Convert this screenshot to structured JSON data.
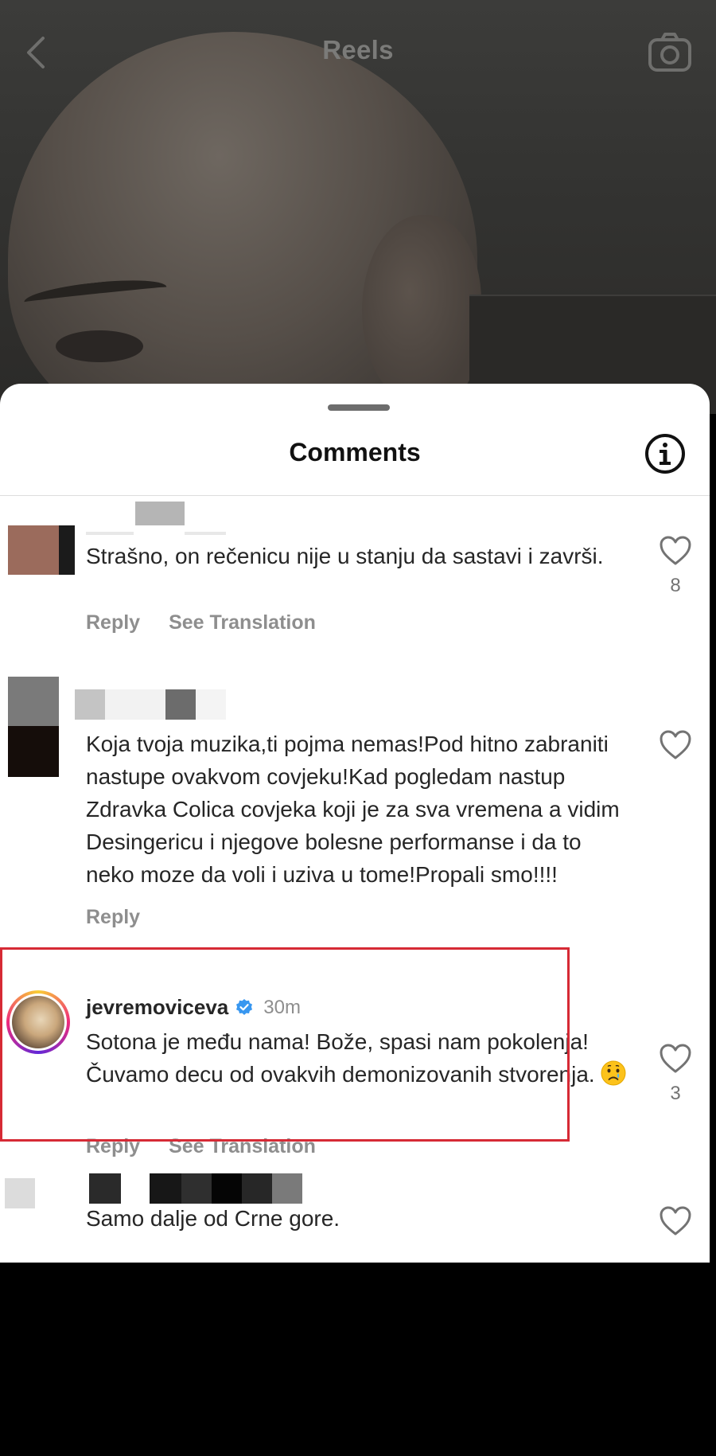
{
  "header": {
    "title": "Reels"
  },
  "sheet": {
    "title": "Comments"
  },
  "comments": [
    {
      "text": "Strašno, on rečenicu nije u stanju da sastavi i završi.",
      "actions": [
        "Reply",
        "See Translation"
      ],
      "likes": "8"
    },
    {
      "text": "Koja tvoja muzika,ti pojma nemas!Pod hitno zabraniti nastupe ovakvom covjeku!Kad pogledam nastup Zdravka Colica covjeka koji je za sva vremena a vidim Desingericu i njegove bolesne performanse i da to neko moze da voli i uziva u tome!Propali smo!!!!",
      "actions": [
        "Reply"
      ],
      "likes": ""
    },
    {
      "username": "jevremoviceva",
      "verified": true,
      "time": "30m",
      "text": "Sotona je među nama! Bože, spasi nam pokolenja! Čuvamo decu od ovakvih demonizovanih stvorenja.",
      "emoji": "crying-face",
      "actions": [
        "Reply",
        "See Translation"
      ],
      "likes": "3",
      "highlighted": true,
      "highlight_color": "#d62a35"
    },
    {
      "text": "Samo dalje od Crne gore.",
      "likes": ""
    }
  ],
  "colors": {
    "verified": "#3897f0",
    "action_text": "#8e8e8e"
  }
}
